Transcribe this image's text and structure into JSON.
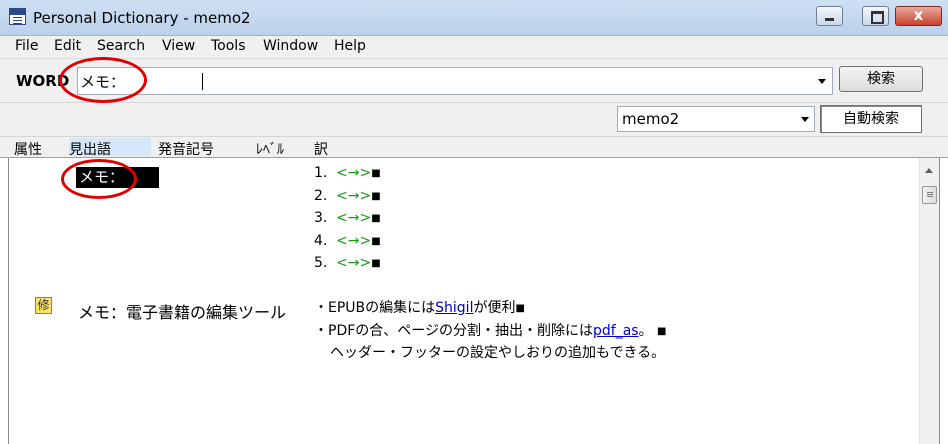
{
  "window": {
    "title": "Personal Dictionary - memo2",
    "close_glyph": "x"
  },
  "menu": [
    "File",
    "Edit",
    "Search",
    "View",
    "Tools",
    "Window",
    "Help"
  ],
  "search": {
    "word_label": "WORD",
    "query": "メモ：",
    "search_button": "検索"
  },
  "options": {
    "dictionary": "memo2",
    "auto_search_button": "自動検索"
  },
  "columns": [
    "属性",
    "見出語",
    "発音記号",
    "ﾚﾍﾞﾙ",
    "訳"
  ],
  "entries": {
    "first": {
      "headword": "メモ：",
      "numbers": [
        "1.",
        "2.",
        "3.",
        "4.",
        "5."
      ],
      "arrow": "<→>",
      "end_mark": "■"
    },
    "second": {
      "badge": "修",
      "headword": "メモ：電子書籍の編集ツール",
      "line1_prefix": "・EPUBの編集には",
      "line1_link": "Shigil",
      "line1_suffix": "が便利",
      "line2_prefix": "・PDFの合、ページの分割・抽出・削除には",
      "line2_link": "pdf_as",
      "line2_suffix": "。",
      "line3": "ヘッダー・フッターの設定やしおりの追加もできる。",
      "end_mark": "■"
    }
  },
  "colors": {
    "annotation": "#e00000",
    "link": "#0000cc",
    "arrow": "#1a9a1a"
  }
}
